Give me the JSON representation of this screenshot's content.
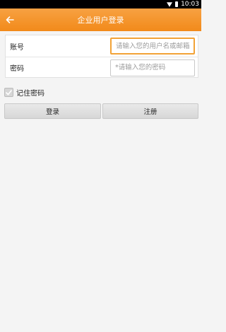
{
  "status_bar": {
    "time": "10:03"
  },
  "header": {
    "title": "企业用户登录"
  },
  "form": {
    "account_label": "账号",
    "account_placeholder": "请输入您的用户名或邮箱",
    "password_label": "密码",
    "password_placeholder": "*请输入您的密码"
  },
  "remember": {
    "label": "记住密码"
  },
  "actions": {
    "login_label": "登录",
    "register_label": "注册"
  },
  "colors": {
    "accent": "#f28a1a",
    "focus_border": "#f2a236"
  },
  "icons": {
    "back": "arrow-left-icon",
    "remember_check": "checkmark-icon",
    "wifi": "wifi-icon",
    "battery": "battery-icon"
  }
}
